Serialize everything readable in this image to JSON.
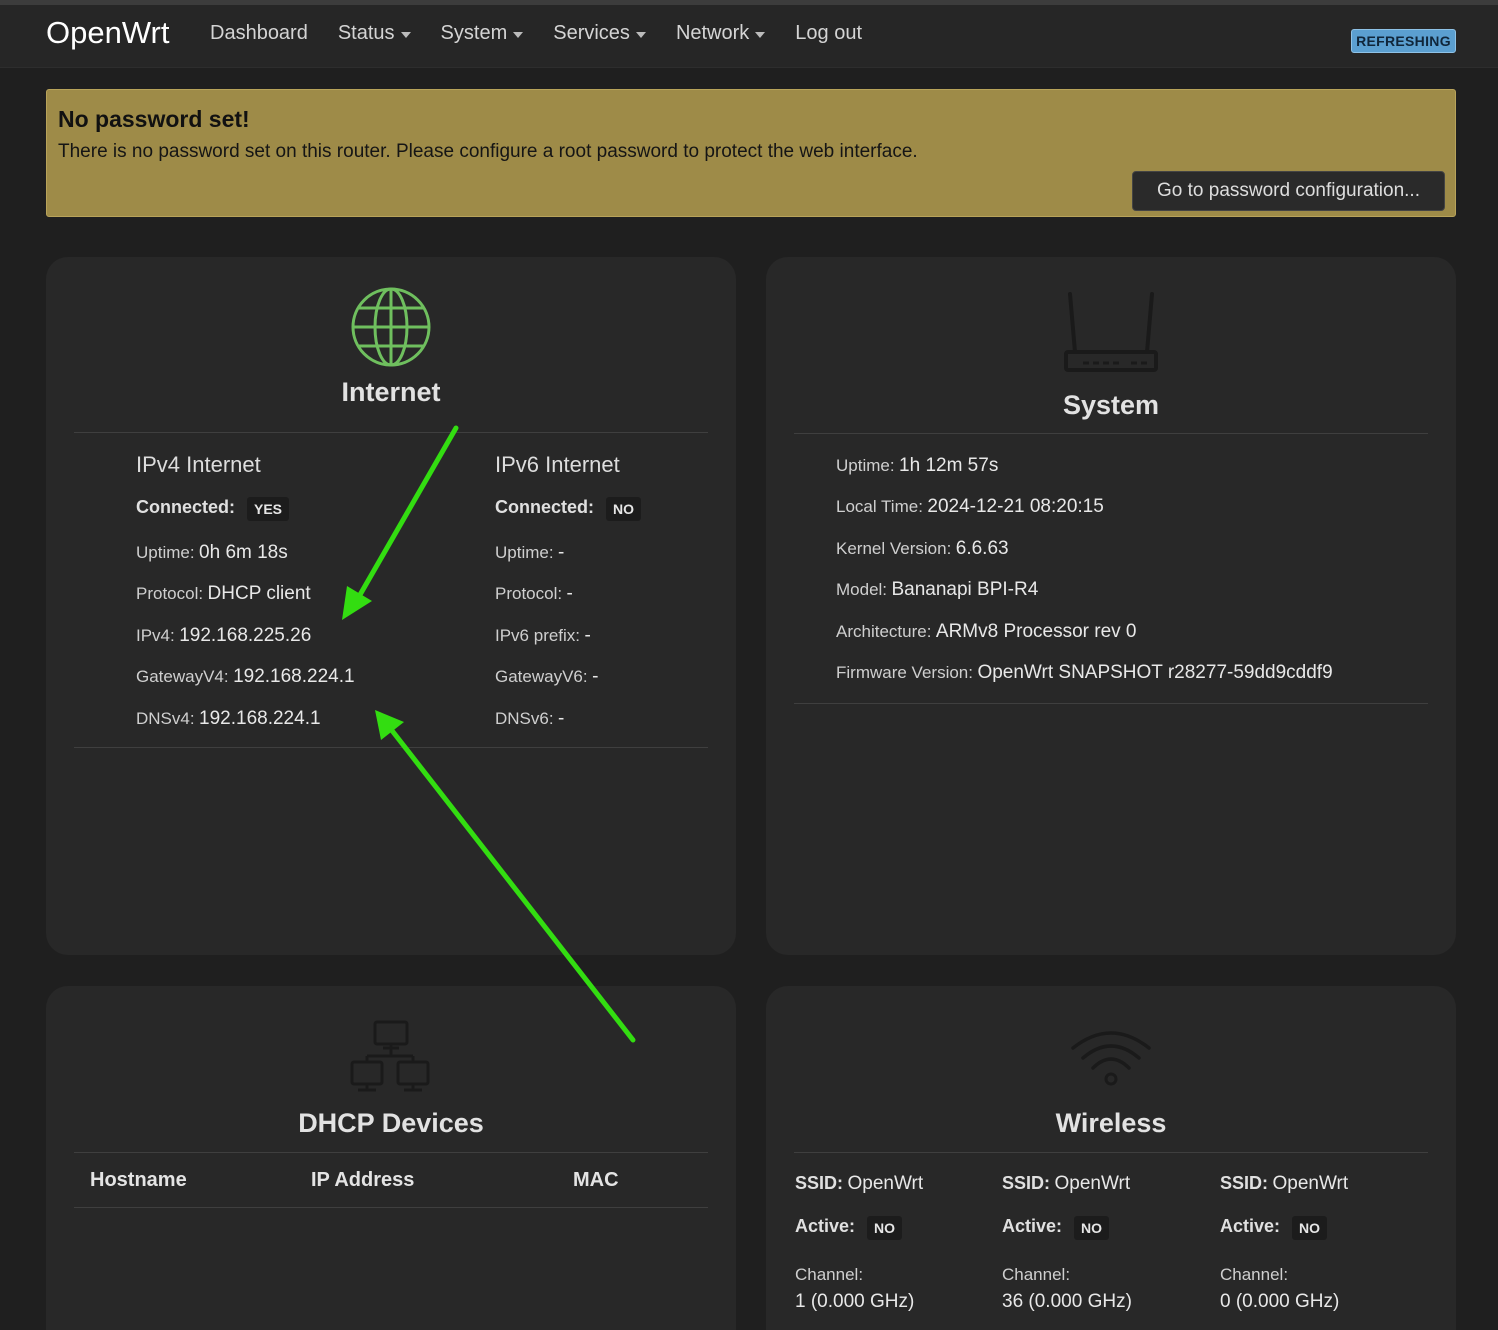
{
  "header": {
    "brand": "OpenWrt",
    "nav": [
      {
        "label": "Dashboard",
        "dropdown": false
      },
      {
        "label": "Status",
        "dropdown": true
      },
      {
        "label": "System",
        "dropdown": true
      },
      {
        "label": "Services",
        "dropdown": true
      },
      {
        "label": "Network",
        "dropdown": true
      },
      {
        "label": "Log out",
        "dropdown": false
      }
    ],
    "refresh_badge": "REFRESHING"
  },
  "alert": {
    "title": "No password set!",
    "text": "There is no password set on this router. Please configure a root password to protect the web interface.",
    "button": "Go to password configuration..."
  },
  "internet": {
    "title": "Internet",
    "ipv4": {
      "heading": "IPv4 Internet",
      "connected_label": "Connected:",
      "connected_value": "YES",
      "uptime_label": "Uptime:",
      "uptime_value": "0h 6m 18s",
      "protocol_label": "Protocol:",
      "protocol_value": "DHCP client",
      "ip_label": "IPv4:",
      "ip_value": "192.168.225.26",
      "gateway_label": "GatewayV4:",
      "gateway_value": "192.168.224.1",
      "dns_label": "DNSv4:",
      "dns_value": "192.168.224.1"
    },
    "ipv6": {
      "heading": "IPv6 Internet",
      "connected_label": "Connected:",
      "connected_value": "NO",
      "uptime_label": "Uptime:",
      "uptime_value": "-",
      "protocol_label": "Protocol:",
      "protocol_value": "-",
      "prefix_label": "IPv6 prefix:",
      "prefix_value": "-",
      "gateway_label": "GatewayV6:",
      "gateway_value": "-",
      "dns_label": "DNSv6:",
      "dns_value": "-"
    }
  },
  "system": {
    "title": "System",
    "rows": [
      {
        "label": "Uptime:",
        "value": "1h 12m 57s"
      },
      {
        "label": "Local Time:",
        "value": "2024-12-21 08:20:15"
      },
      {
        "label": "Kernel Version:",
        "value": "6.6.63"
      },
      {
        "label": "Model:",
        "value": "Bananapi BPI-R4"
      },
      {
        "label": "Architecture:",
        "value": "ARMv8 Processor rev 0"
      },
      {
        "label": "Firmware Version:",
        "value": "OpenWrt SNAPSHOT r28277-59dd9cddf9"
      }
    ]
  },
  "dhcp": {
    "title": "DHCP Devices",
    "columns": [
      "Hostname",
      "IP Address",
      "MAC"
    ]
  },
  "wireless": {
    "title": "Wireless",
    "radios": [
      {
        "ssid_label": "SSID:",
        "ssid": "OpenWrt",
        "active_label": "Active:",
        "active": "NO",
        "channel_label": "Channel:",
        "channel": "1 (0.000 GHz)"
      },
      {
        "ssid_label": "SSID:",
        "ssid": "OpenWrt",
        "active_label": "Active:",
        "active": "NO",
        "channel_label": "Channel:",
        "channel": "36 (0.000 GHz)"
      },
      {
        "ssid_label": "SSID:",
        "ssid": "OpenWrt",
        "active_label": "Active:",
        "active": "NO",
        "channel_label": "Channel:",
        "channel": "0 (0.000 GHz)"
      }
    ]
  },
  "colors": {
    "background": "#1f1f1f",
    "card": "#282828",
    "alert": "#9e8b48",
    "badge": "#5b9fd0",
    "internet_icon": "#6fbf5e",
    "annotation_arrow": "#33dd11"
  },
  "icons": [
    "globe-icon",
    "router-icon",
    "network-devices-icon",
    "wifi-icon"
  ]
}
